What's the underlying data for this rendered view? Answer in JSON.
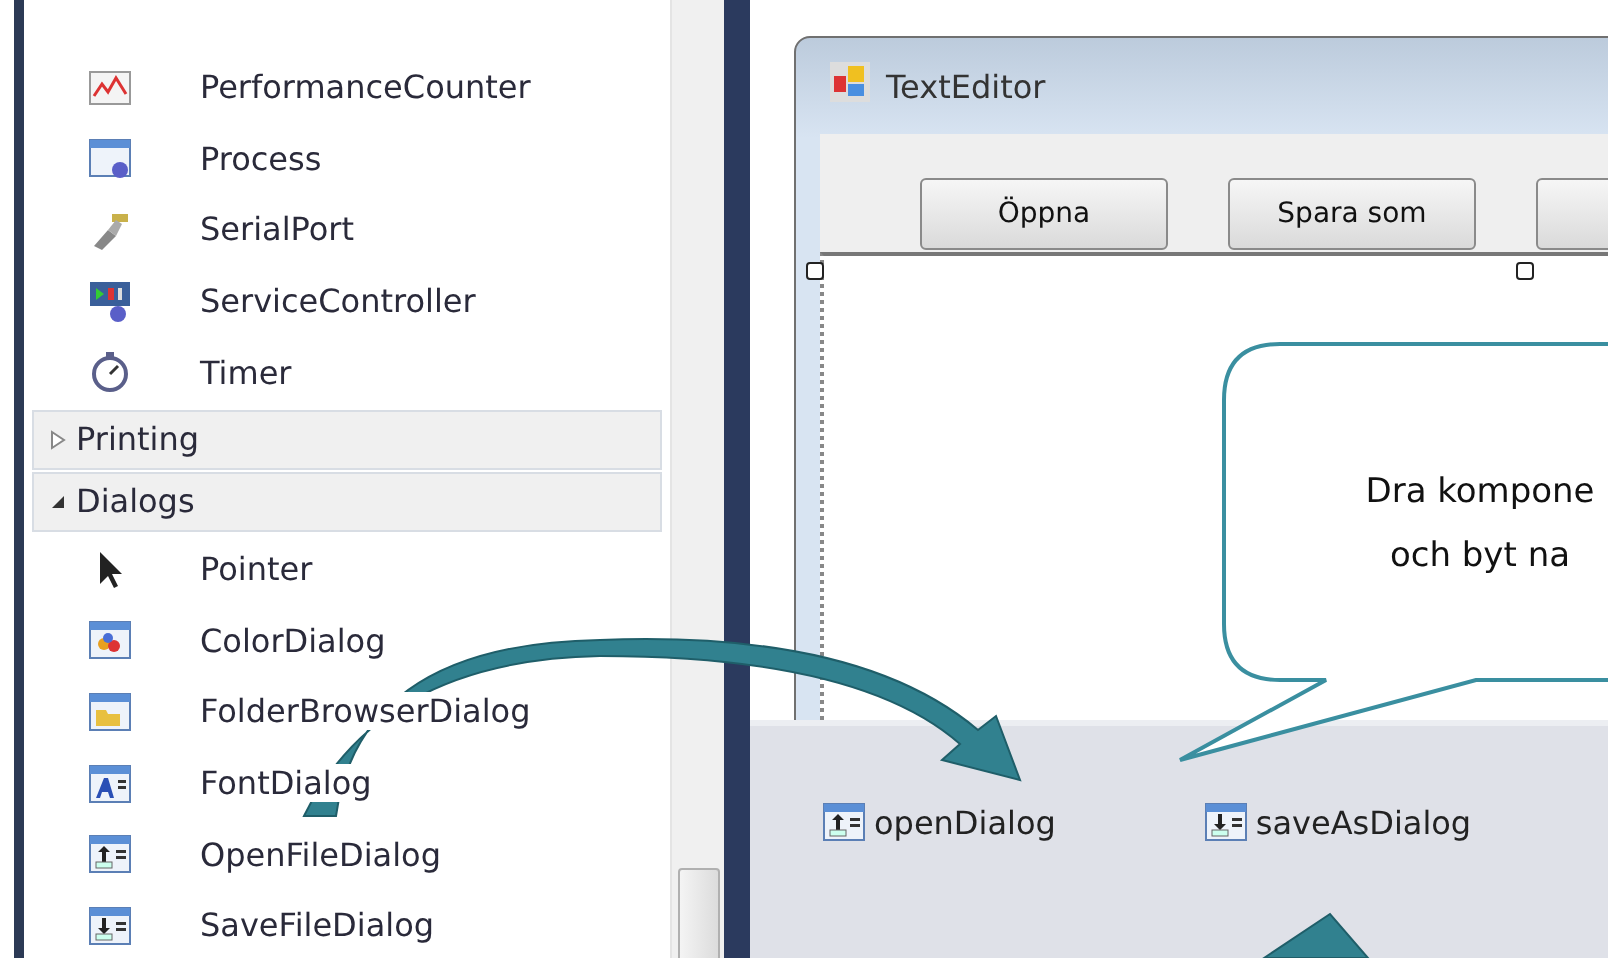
{
  "toolbox": {
    "items": [
      {
        "kind": "item",
        "label": "PerformanceCounter"
      },
      {
        "kind": "item",
        "label": "Process"
      },
      {
        "kind": "item",
        "label": "SerialPort"
      },
      {
        "kind": "item",
        "label": "ServiceController"
      },
      {
        "kind": "item",
        "label": "Timer"
      },
      {
        "kind": "group",
        "label": "Printing",
        "expanded": false
      },
      {
        "kind": "group",
        "label": "Dialogs",
        "expanded": true
      },
      {
        "kind": "item",
        "label": "Pointer"
      },
      {
        "kind": "item",
        "label": "ColorDialog"
      },
      {
        "kind": "item",
        "label": "FolderBrowserDialog"
      },
      {
        "kind": "item",
        "label": "FontDialog"
      },
      {
        "kind": "item",
        "label": "OpenFileDialog"
      },
      {
        "kind": "item",
        "label": "SaveFileDialog"
      }
    ]
  },
  "form": {
    "title": "TextEditor",
    "buttons": [
      {
        "kind": "full",
        "label": "Öppna"
      },
      {
        "kind": "full",
        "label": "Spara som"
      },
      {
        "kind": "cut"
      }
    ]
  },
  "callout": {
    "lines": [
      "Dra kompone",
      "och byt na"
    ]
  },
  "tray": [
    {
      "label": "openDialog"
    },
    {
      "label": "saveAsDialog"
    }
  ]
}
